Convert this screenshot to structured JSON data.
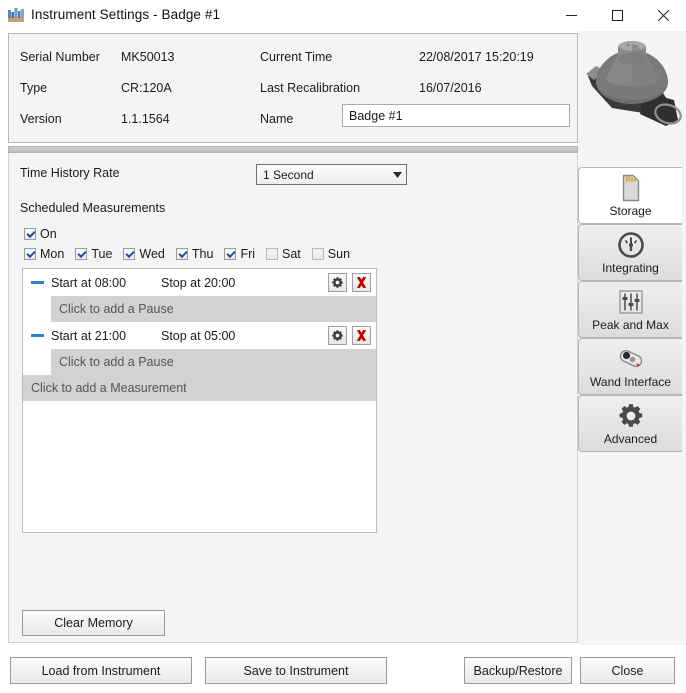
{
  "window": {
    "title": "Instrument Settings - Badge #1",
    "icon": "badge-app-icon",
    "minimize_label": "Minimize",
    "maximize_label": "Maximize",
    "close_label": "Close"
  },
  "info_panel": {
    "rows": [
      {
        "label": "Serial Number",
        "value": "MK50013"
      },
      {
        "label": "Type",
        "value": "CR:120A"
      },
      {
        "label": "Version",
        "value": "1.1.1564"
      }
    ],
    "right_rows": [
      {
        "label": "Current Time",
        "value": "22/08/2017 15:20:19"
      },
      {
        "label": "Last Recalibration",
        "value": "16/07/2016"
      }
    ],
    "name_label": "Name",
    "name_value": "Badge #1",
    "name_placeholder": "Badge #1"
  },
  "settings": {
    "time_history_rate_label": "Time History Rate",
    "time_history_rate_value": "1 Second",
    "time_history_rate_options": [
      "1 Second"
    ],
    "scheduled_measurements_label": "Scheduled Measurements",
    "on": {
      "label": "On",
      "checked": true
    },
    "days": [
      {
        "label": "Mon",
        "checked": true
      },
      {
        "label": "Tue",
        "checked": true
      },
      {
        "label": "Wed",
        "checked": true
      },
      {
        "label": "Thu",
        "checked": true
      },
      {
        "label": "Fri",
        "checked": true
      },
      {
        "label": "Sat",
        "checked": false
      },
      {
        "label": "Sun",
        "checked": false
      }
    ],
    "measurements": [
      {
        "start": "Start at 08:00",
        "stop": "Stop at 20:00",
        "collapse_icon": "minus-icon",
        "settings_icon": "gear-icon",
        "delete_icon": "red-x-icon",
        "add_pause_label": "Click to add a Pause"
      },
      {
        "start": "Start at 21:00",
        "stop": "Stop at 05:00",
        "collapse_icon": "minus-icon",
        "settings_icon": "gear-icon",
        "delete_icon": "red-x-icon",
        "add_pause_label": "Click to add a Pause"
      }
    ],
    "add_measurement_label": "Click to add a Measurement",
    "clear_memory_label": "Clear Memory"
  },
  "tabs": [
    {
      "label": "Storage",
      "icon": "sd-card-icon",
      "active": true
    },
    {
      "label": "Integrating",
      "icon": "gauge-icon",
      "active": false
    },
    {
      "label": "Peak and Max",
      "icon": "sliders-icon",
      "active": false
    },
    {
      "label": "Wand Interface",
      "icon": "wand-icon",
      "active": false
    },
    {
      "label": "Advanced",
      "icon": "gear-icon",
      "active": false
    }
  ],
  "device_image_name": "badge-dosimeter-photo",
  "footer": {
    "load_label": "Load from Instrument",
    "save_label": "Save to Instrument",
    "backup_label": "Backup/Restore",
    "close_label": "Close"
  },
  "colors": {
    "accent_blue": "#2b7fd4",
    "danger_red": "#c00000",
    "panel_bg": "#f4f4f4",
    "row_alt": "#d2d2d2"
  }
}
